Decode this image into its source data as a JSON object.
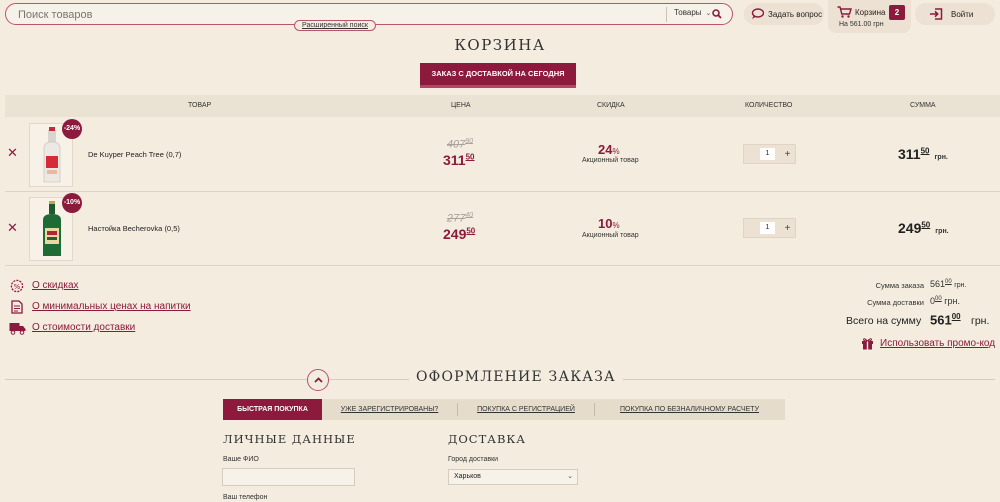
{
  "header": {
    "search_placeholder": "Поиск товаров",
    "search_scope": "Товары",
    "advanced_search": "Расширенный поиск",
    "ask_question": "Задать вопрос",
    "cart_label": "Корзина",
    "cart_total": "На 561.00 грн",
    "cart_count": "2",
    "login": "Войти"
  },
  "page_title": "Корзина",
  "delivery_tab": "Заказ с доставкой на сегодня",
  "table": {
    "headers": {
      "product": "Товар",
      "price": "Цена",
      "discount": "Скидка",
      "quantity": "Количество",
      "sum": "Сумма"
    },
    "rows": [
      {
        "badge": "-24%",
        "name": "De Kuyper Peach Tree (0,7)",
        "old_price_int": "407",
        "old_price_frac": "90",
        "price_int": "311",
        "price_frac": "50",
        "discount_value": "24",
        "discount_unit": "%",
        "promo_note": "Акционный товар",
        "qty": "1",
        "sum_int": "311",
        "sum_frac": "50",
        "currency": "грн."
      },
      {
        "badge": "-10%",
        "name": "Настойка Becherovka (0,5)",
        "old_price_int": "277",
        "old_price_frac": "40",
        "price_int": "249",
        "price_frac": "50",
        "discount_value": "10",
        "discount_unit": "%",
        "promo_note": "Акционный товар",
        "qty": "1",
        "sum_int": "249",
        "sum_frac": "50",
        "currency": "грн."
      }
    ]
  },
  "info_links": {
    "discounts": "О скидках",
    "min_prices": "О минимальных ценах на напитки",
    "delivery_cost": "О стоимости доставки"
  },
  "totals": {
    "order_sum_label": "Сумма заказа",
    "order_sum_int": "561",
    "order_sum_frac": "00",
    "order_sum_cur": "грн.",
    "delivery_sum_label": "Сумма доставки",
    "delivery_sum_int": "0",
    "delivery_sum_frac": "00",
    "delivery_sum_cur": "грн.",
    "grand_label": "Всего на сумму",
    "grand_int": "561",
    "grand_frac": "00",
    "grand_cur": "грн.",
    "promo_code": "Использовать промо-код"
  },
  "checkout": {
    "title": "Оформление заказа",
    "tabs": [
      "Быстрая покупка",
      "Уже зарегистрированы?",
      "Покупка с регистрацией",
      "Покупка по безналичному расчету"
    ],
    "personal_title": "Личные данные",
    "name_label": "Ваше ФИО",
    "phone_label": "Ваш телефон",
    "delivery_title": "Доставка",
    "city_label": "Город доставки",
    "city_value": "Харьков"
  },
  "colors": {
    "accent": "#8c1a3d",
    "background": "#f3ecdf"
  }
}
